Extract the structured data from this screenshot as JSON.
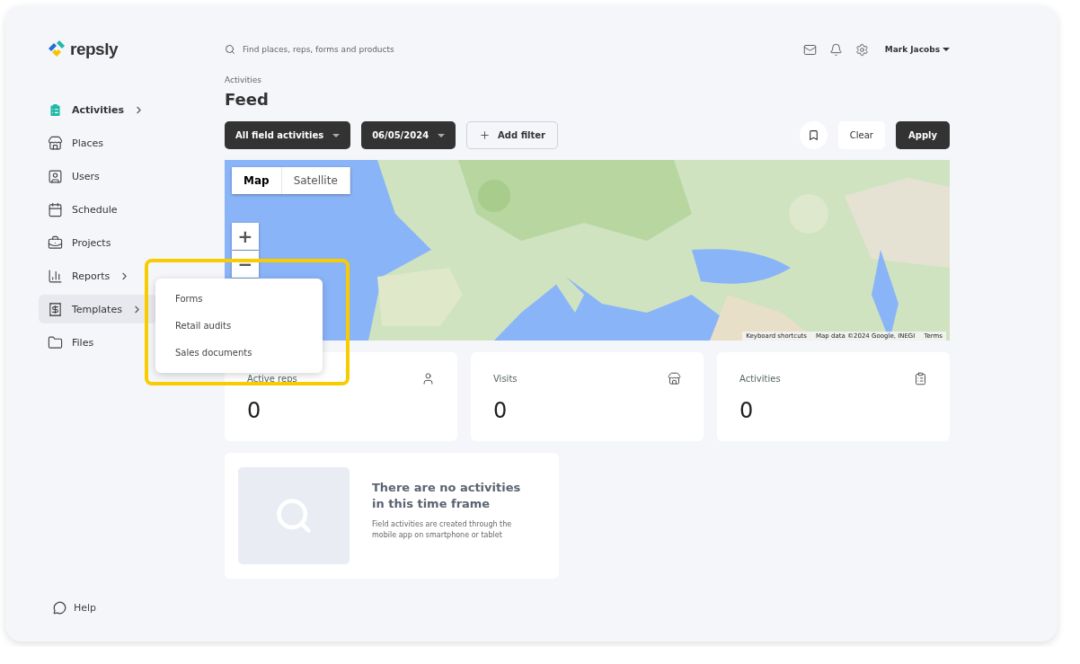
{
  "logo": {
    "text": "repsly"
  },
  "sidebar": {
    "items": [
      {
        "label": "Activities",
        "expandable": true,
        "selected": true,
        "hovered": false
      },
      {
        "label": "Places",
        "expandable": false,
        "selected": false,
        "hovered": false
      },
      {
        "label": "Users",
        "expandable": false,
        "selected": false,
        "hovered": false
      },
      {
        "label": "Schedule",
        "expandable": false,
        "selected": false,
        "hovered": false
      },
      {
        "label": "Projects",
        "expandable": false,
        "selected": false,
        "hovered": false
      },
      {
        "label": "Reports",
        "expandable": true,
        "selected": false,
        "hovered": false
      },
      {
        "label": "Templates",
        "expandable": true,
        "selected": false,
        "hovered": true
      },
      {
        "label": "Files",
        "expandable": false,
        "selected": false,
        "hovered": false
      }
    ],
    "help": "Help"
  },
  "search": {
    "placeholder": "Find places, reps, forms and products"
  },
  "user": {
    "name": "Mark Jacobs"
  },
  "breadcrumb": "Activities",
  "title": "Feed",
  "filters": [
    {
      "label": "All field activities",
      "kind": "dropdown"
    },
    {
      "label": "06/05/2024",
      "kind": "dropdown"
    },
    {
      "label": "Add filter",
      "kind": "add"
    }
  ],
  "actions": {
    "clear": "Clear",
    "apply": "Apply"
  },
  "map": {
    "kind": "picture",
    "types": [
      {
        "label": "Map",
        "selected": true
      },
      {
        "label": "Satellite",
        "selected": false
      }
    ],
    "zoom_in": "+",
    "zoom_out": "−",
    "attribution": [
      "Keyboard shortcuts",
      "Map data ©2024 Google, INEGI",
      "Terms"
    ]
  },
  "stats": [
    {
      "label": "Active reps",
      "value": "0"
    },
    {
      "label": "Visits",
      "value": "0"
    },
    {
      "label": "Activities",
      "value": "0"
    }
  ],
  "popover": {
    "items": [
      "Forms",
      "Retail audits",
      "Sales documents"
    ]
  },
  "empty": {
    "title": "There are no activities in this time frame",
    "text": "Field activities are created through the mobile app on smartphone or tablet"
  }
}
